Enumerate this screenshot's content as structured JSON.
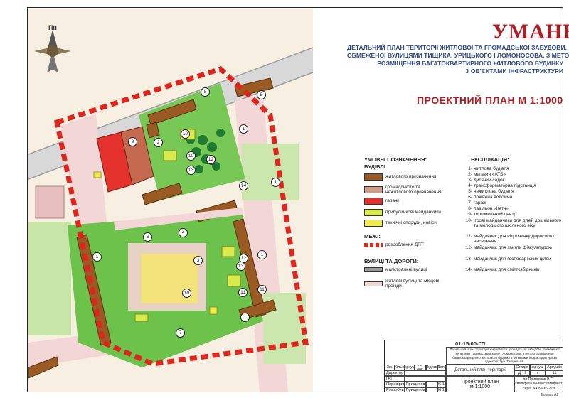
{
  "header": {
    "city": "УМАНЬ",
    "description": [
      "ДЕТАЛЬНИЙ ПЛАН ТЕРИТОРІЇ ЖИТЛОВОЇ ТА ГРОМАДСЬКОЇ ЗАБУДОВИ,",
      "ОБМЕЖЕНОЇ ВУЛИЦЯМИ ТИЩИКА, УРИЦЬКОГО І ЛОМОНОСОВА, З МЕТОЮ",
      "РОЗМІЩЕННЯ БАГАТОКВАРТИРНОГО ЖИТЛОВОГО БУДИНКУ",
      "З ОБ'ЄКТАМИ ІНФРАСТРУКТУРИ"
    ],
    "plan_title": "ПРОЕКТНИЙ ПЛАН М 1:1000"
  },
  "compass": {
    "label": "Пн"
  },
  "colors": {
    "residential": "#9a5a24",
    "public_residential": "#cf9c86",
    "garage": "#e6322c",
    "playground": "#d9ea4a",
    "technical": "#f2e94c",
    "boundary": "#e0251d",
    "green": "#6cc24a",
    "title_red": "#b01d22",
    "title_blue": "#2e4a86"
  },
  "legend": {
    "title": "УМОВНІ ПОЗНАЧЕННЯ:",
    "buildings_heading": "БУДІВЛІ:",
    "items": [
      "житлового призначення",
      "громадського та нежитлового призначення",
      "гаражі",
      "прибудинкові майданчики",
      "технічні споруди, навіси"
    ],
    "boundaries_heading": "МЕЖІ:",
    "boundary_label": "розроблення ДПТ",
    "roads_heading": "ВУЛИЦІ ТА ДОРОГИ:",
    "roads": [
      "магістральні вулиці",
      "житлові вулиці та місцеві проїзди"
    ]
  },
  "explication": {
    "title": "ЕКСПЛІКАЦІЯ:",
    "items": [
      {
        "num": "1-",
        "text": "житлова будівля"
      },
      {
        "num": "2-",
        "text": "магазин «АТБ»"
      },
      {
        "num": "3-",
        "text": "дитячий садок"
      },
      {
        "num": "4-",
        "text": "трансформаторна підстанція"
      },
      {
        "num": "5-",
        "text": "нежитлова будівля"
      },
      {
        "num": "6-",
        "text": "пожежна водойма"
      },
      {
        "num": "7-",
        "text": "гараж"
      },
      {
        "num": "8-",
        "text": "павільон «Кетч»"
      },
      {
        "num": "9-",
        "text": "торговельний центр"
      },
      {
        "num": "10-",
        "text": "ігрові майданчики для дітей дошкільного та молодшого шкільного віку"
      },
      {
        "num": "11-",
        "text": "майданчик для відпочинку дорослого населення"
      },
      {
        "num": "12-",
        "text": "майданчик для занять фізкультурою"
      },
      {
        "num": "13-",
        "text": "майданчик для господарських цілей"
      },
      {
        "num": "14-",
        "text": "майданчик для сміттєзбірників"
      }
    ]
  },
  "stamp": {
    "code": "01-15-00-ГП",
    "project_description": "Детальний план території житлової та громадської забудови, обмеженої вулицями Тищика, Урицького і Ломоносова, з метою розміщення багатоквартирного житлового будинку з об'єктами інфраструктури за адресою: вул. Тищика, 6б.",
    "columns": [
      "Зм.",
      "Кільк.",
      "Аркуш",
      "№ док.",
      "Підпис",
      "Дата"
    ],
    "director_label": "Директор",
    "gap_label": "ГАП",
    "checked_label": "Перевірив",
    "developed_label": "Розробив",
    "checked_name": "Прищепов",
    "developed_name": "Прищепов",
    "date1": "06.15",
    "date2": "06.15",
    "sheet_title": "Детальний план території",
    "stage_header": "Стадія",
    "sheet_header": "Аркуш",
    "sheets_header": "Аркушів",
    "stage": "ДПТ",
    "sheet_num": "7",
    "sheets_total": "11",
    "drawing_title_1": "Проектний план",
    "drawing_title_2": "м 1:1000",
    "author_1": "пп Прищепов В.О.",
    "author_2": "кваліфікаційний сертифікат",
    "author_3": "серія АА №002278",
    "format": "Формат А2"
  },
  "map_labels": [
    "1",
    "1",
    "1",
    "1",
    "1",
    "2",
    "3",
    "4",
    "5",
    "6",
    "7",
    "8",
    "9",
    "10",
    "10",
    "10",
    "10",
    "11",
    "11",
    "12",
    "12",
    "13",
    "13",
    "14"
  ]
}
